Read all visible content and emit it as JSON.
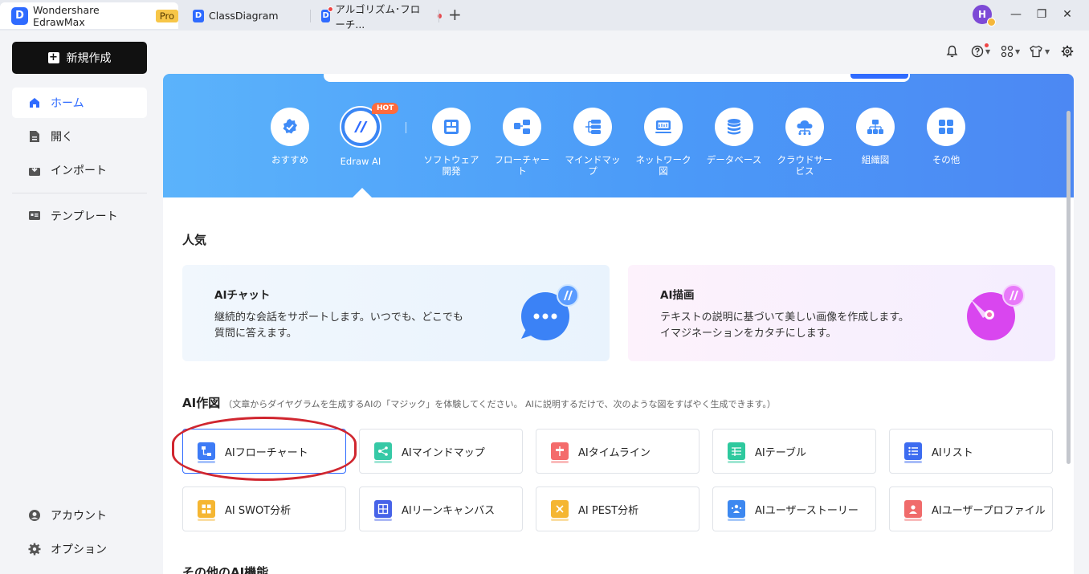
{
  "tabs": [
    {
      "label": "Wondershare EdrawMax",
      "badge": "Pro",
      "icon": "edrawmax-logo-icon"
    },
    {
      "label": "ClassDiagram",
      "icon": "document-icon"
    },
    {
      "label": "アルゴリズム･フローチ...",
      "icon": "document-icon",
      "unsaved": true
    }
  ],
  "app_logo_letter": "D",
  "doc_logo_letter": "D",
  "new_tab_glyph": "+",
  "avatar_initial": "H",
  "window": {
    "minimize": "—",
    "maximize": "❐",
    "close": "✕"
  },
  "sidebar": {
    "new_button": "新規作成",
    "items": [
      {
        "label": "ホーム",
        "icon": "home-icon",
        "active": true
      },
      {
        "label": "開く",
        "icon": "open-file-icon"
      },
      {
        "label": "インポート",
        "icon": "import-icon"
      },
      {
        "label": "テンプレート",
        "icon": "template-icon"
      }
    ],
    "bottom_items": [
      {
        "label": "アカウント",
        "icon": "account-icon"
      },
      {
        "label": "オプション",
        "icon": "settings-icon"
      }
    ]
  },
  "toolbar": {
    "icons": [
      "bell-icon",
      "help-icon",
      "apps-icon",
      "theme-icon",
      "gear-icon"
    ]
  },
  "categories": [
    {
      "label": "おすすめ",
      "icon": "recommend-icon"
    },
    {
      "label": "Edraw AI",
      "icon": "edraw-ai-icon",
      "badge": "HOT"
    },
    {
      "label": "ソフトウェア開発",
      "icon": "software-icon"
    },
    {
      "label": "フローチャート",
      "icon": "flowchart-icon"
    },
    {
      "label": "マインドマップ",
      "icon": "mindmap-icon"
    },
    {
      "label": "ネットワーク図",
      "icon": "network-icon"
    },
    {
      "label": "データベース",
      "icon": "database-icon"
    },
    {
      "label": "クラウドサービス",
      "icon": "cloud-icon"
    },
    {
      "label": "組織図",
      "icon": "org-chart-icon"
    },
    {
      "label": "その他",
      "icon": "more-icon"
    }
  ],
  "popular": {
    "title": "人気",
    "cards": [
      {
        "title": "AIチャット",
        "desc": "継続的な会話をサポートします。いつでも、どこでも質問に答えます。",
        "icon": "ai-chat-icon"
      },
      {
        "title": "AI描画",
        "desc": "テキストの説明に基づいて美しい画像を作成します。イマジネーションをカタチにします。",
        "icon": "ai-drawing-icon"
      }
    ]
  },
  "ai_diagram": {
    "title": "AI作図",
    "subtitle": "（文章からダイヤグラムを生成するAIの「マジック」を体験してください。 AIに説明するだけで、次のような図をすばやく生成できます。）",
    "items": [
      {
        "label": "AIフローチャート",
        "icon": "ai-flowchart-icon",
        "color": "#3d7bf6"
      },
      {
        "label": "AIマインドマップ",
        "icon": "ai-mindmap-icon",
        "color": "#36c9a6"
      },
      {
        "label": "AIタイムライン",
        "icon": "ai-timeline-icon",
        "color": "#f46b6b"
      },
      {
        "label": "AIテーブル",
        "icon": "ai-table-icon",
        "color": "#2ec99e"
      },
      {
        "label": "AIリスト",
        "icon": "ai-list-icon",
        "color": "#3d6cf0"
      },
      {
        "label": "AI SWOT分析",
        "icon": "ai-swot-icon",
        "color": "#f5b632"
      },
      {
        "label": "AIリーンキャンバス",
        "icon": "ai-lean-canvas-icon",
        "color": "#4763e8"
      },
      {
        "label": "AI PEST分析",
        "icon": "ai-pest-icon",
        "color": "#f5b632"
      },
      {
        "label": "AIユーザーストーリー",
        "icon": "ai-user-story-icon",
        "color": "#3d88f0"
      },
      {
        "label": "AIユーザープロファイル",
        "icon": "ai-user-profile-icon",
        "color": "#f06b6b"
      }
    ]
  },
  "other_ai": {
    "title": "その他のAI機能"
  }
}
